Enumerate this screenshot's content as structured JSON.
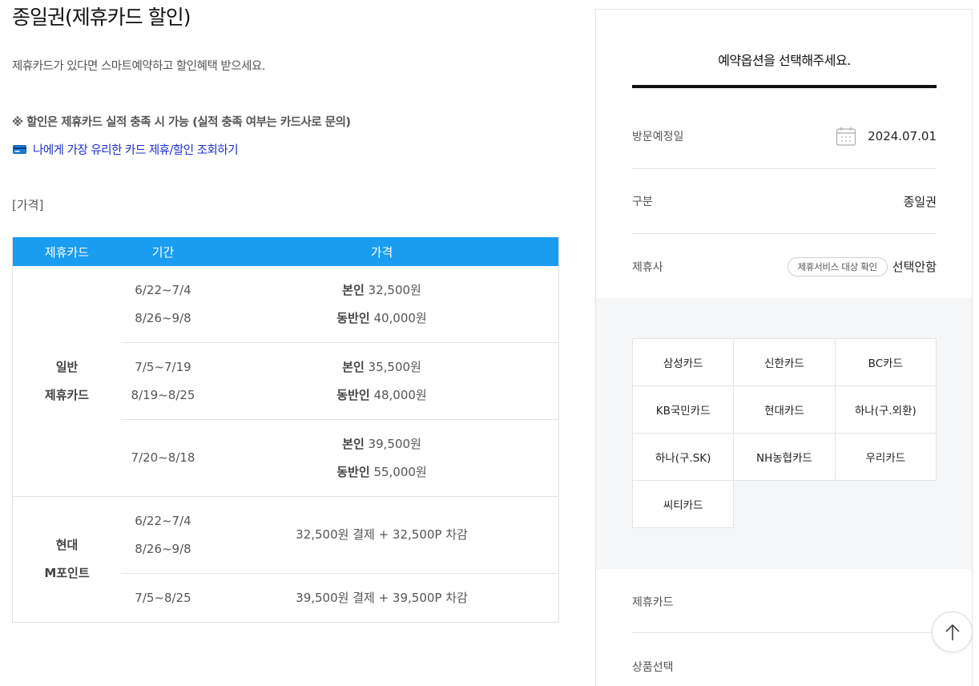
{
  "header": {
    "title": "종일권(제휴카드 할인)"
  },
  "intro": {
    "description": "제휴카드가 있다면 스마트예약하고 할인혜택 받으세요.",
    "notice": "※ 할인은 제휴카드 실적 충족 시 가능 (실적 충족 여부는 카드사로 문의)",
    "link_text": "나에게 가장 유리한 카드 제휴/할인 조회하기",
    "link_icon": "credit-card-icon"
  },
  "price_section": {
    "label": "[가격]"
  },
  "price_table": {
    "headers": [
      "제휴카드",
      "기간",
      "가격"
    ],
    "label_self": "본인",
    "label_companion": "동반인",
    "general": {
      "category_line1": "일반",
      "category_line2": "제휴카드",
      "rows": [
        {
          "period_line1": "6/22~7/4",
          "period_line2": "8/26~9/8",
          "self_price": "32,500원",
          "companion_price": "40,000원"
        },
        {
          "period_line1": "7/5~7/19",
          "period_line2": "8/19~8/25",
          "self_price": "35,500원",
          "companion_price": "48,000원"
        },
        {
          "period_line1": "7/20~8/18",
          "self_price": "39,500원",
          "companion_price": "55,000원"
        }
      ]
    },
    "hyundai": {
      "category_line1": "현대",
      "category_line2": "M포인트",
      "rows": [
        {
          "period_line1": "6/22~7/4",
          "period_line2": "8/26~9/8",
          "price": "32,500원 결제 + 32,500P 차감"
        },
        {
          "period_line1": "7/5~8/25",
          "price": "39,500원 결제 + 39,500P 차감"
        }
      ]
    }
  },
  "booking_panel": {
    "title": "예약옵션을 선택해주세요.",
    "visit_date": {
      "label": "방문예정일",
      "value": "2024.07.01",
      "icon": "calendar-icon"
    },
    "category": {
      "label": "구분",
      "value": "종일권"
    },
    "partner": {
      "label": "제휴사",
      "pill": "제휴서비스 대상 확인",
      "value": "선택안함"
    },
    "cards": [
      "삼성카드",
      "신한카드",
      "BC카드",
      "KB국민카드",
      "현대카드",
      "하나(구.외환)",
      "하나(구.SK)",
      "NH농협카드",
      "우리카드",
      "씨티카드"
    ],
    "partner_card_label": "제휴카드",
    "product_label": "상품선택"
  },
  "scroll_top": {
    "icon": "arrow-up-icon"
  },
  "colors": {
    "table_header": "#1a9cf0",
    "link": "#1a2fd0",
    "panel_gray": "#f5f6f8"
  }
}
